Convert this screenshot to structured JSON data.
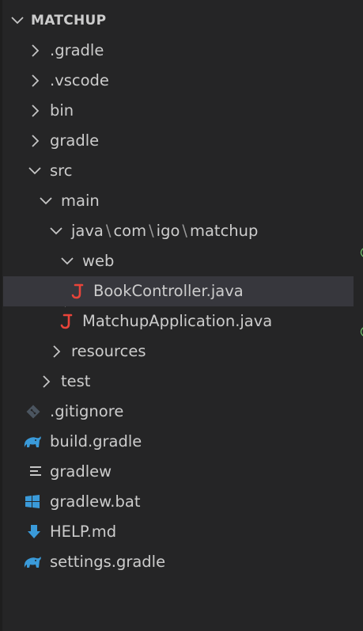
{
  "explorer": {
    "project_title": "MATCHUP"
  },
  "tree": {
    "items": [
      {
        "label": ".gradle"
      },
      {
        "label": ".vscode"
      },
      {
        "label": "bin"
      },
      {
        "label": "gradle"
      },
      {
        "label": "src"
      },
      {
        "label": "main"
      },
      {
        "path_parts": [
          "java",
          "com",
          "igo",
          "matchup"
        ],
        "separator": "\\"
      },
      {
        "label": "web"
      },
      {
        "label": "BookController.java",
        "icon": "java-icon",
        "selected": true,
        "icon_color": "#e8443a"
      },
      {
        "label": "MatchupApplication.java",
        "icon": "java-icon",
        "icon_color": "#e8443a"
      },
      {
        "label": "resources"
      },
      {
        "label": "test"
      },
      {
        "label": ".gitignore",
        "icon": "git-icon"
      },
      {
        "label": "build.gradle",
        "icon": "gradle-elephant-icon",
        "icon_color": "#3a9ad9"
      },
      {
        "label": "gradlew",
        "icon": "lines-icon"
      },
      {
        "label": "gradlew.bat",
        "icon": "windows-icon",
        "icon_color": "#3a9ad9"
      },
      {
        "label": "HELP.md",
        "icon": "markdown-download-icon",
        "icon_color": "#3a9ad9"
      },
      {
        "label": "settings.gradle",
        "icon": "gradle-elephant-icon",
        "icon_color": "#3a9ad9"
      }
    ]
  }
}
